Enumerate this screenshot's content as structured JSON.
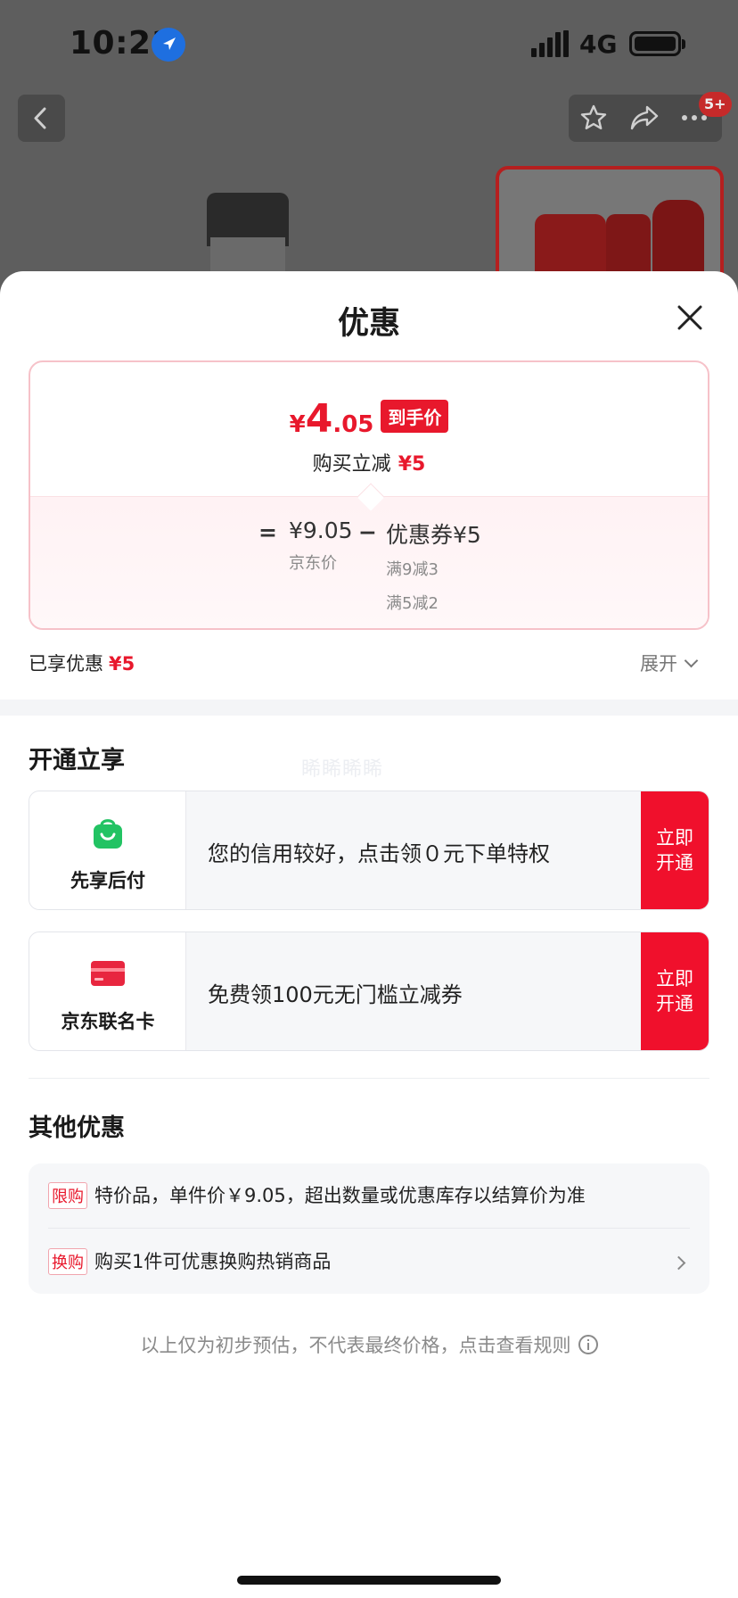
{
  "status_bar": {
    "time": "10:21",
    "network": "4G"
  },
  "header": {
    "badge": "5+"
  },
  "sheet": {
    "title": "优惠",
    "price_card": {
      "final_price": {
        "currency": "¥",
        "integer": "4",
        "decimal": ".05",
        "tag": "到手价"
      },
      "reduction": {
        "text": "购买立减",
        "amount": "¥5"
      },
      "calc": {
        "equals": "=",
        "jd_price": "¥9.05",
        "jd_price_label": "京东价",
        "minus": "−",
        "coupon": "优惠券¥5",
        "coupon_rules": [
          "满9减3",
          "满5减2"
        ]
      }
    },
    "enjoyed": {
      "label": "已享优惠",
      "amount": "¥5"
    },
    "expand_label": "展开",
    "open_section": {
      "title": "开通立享",
      "watermark": "睎睎睎睎",
      "offers": [
        {
          "name": "先享后付",
          "desc": "您的信用较好，点击领０元下单特权",
          "cta_line1": "立即",
          "cta_line2": "开通"
        },
        {
          "name": "京东联名卡",
          "desc": "免费领100元无门槛立减券",
          "cta_line1": "立即",
          "cta_line2": "开通"
        }
      ]
    },
    "other_section": {
      "title": "其他优惠",
      "rows": [
        {
          "tag": "限购",
          "text": "特价品，单件价￥9.05，超出数量或优惠库存以结算价为准"
        },
        {
          "tag": "换购",
          "text": "购买1件可优惠换购热销商品"
        }
      ]
    },
    "footer_note": "以上仅为初步预估，不代表最终价格，点击查看规则"
  },
  "colors": {
    "accent_red": "#e8182c",
    "cta_red": "#f0102c",
    "icon_green": "#22c363"
  }
}
